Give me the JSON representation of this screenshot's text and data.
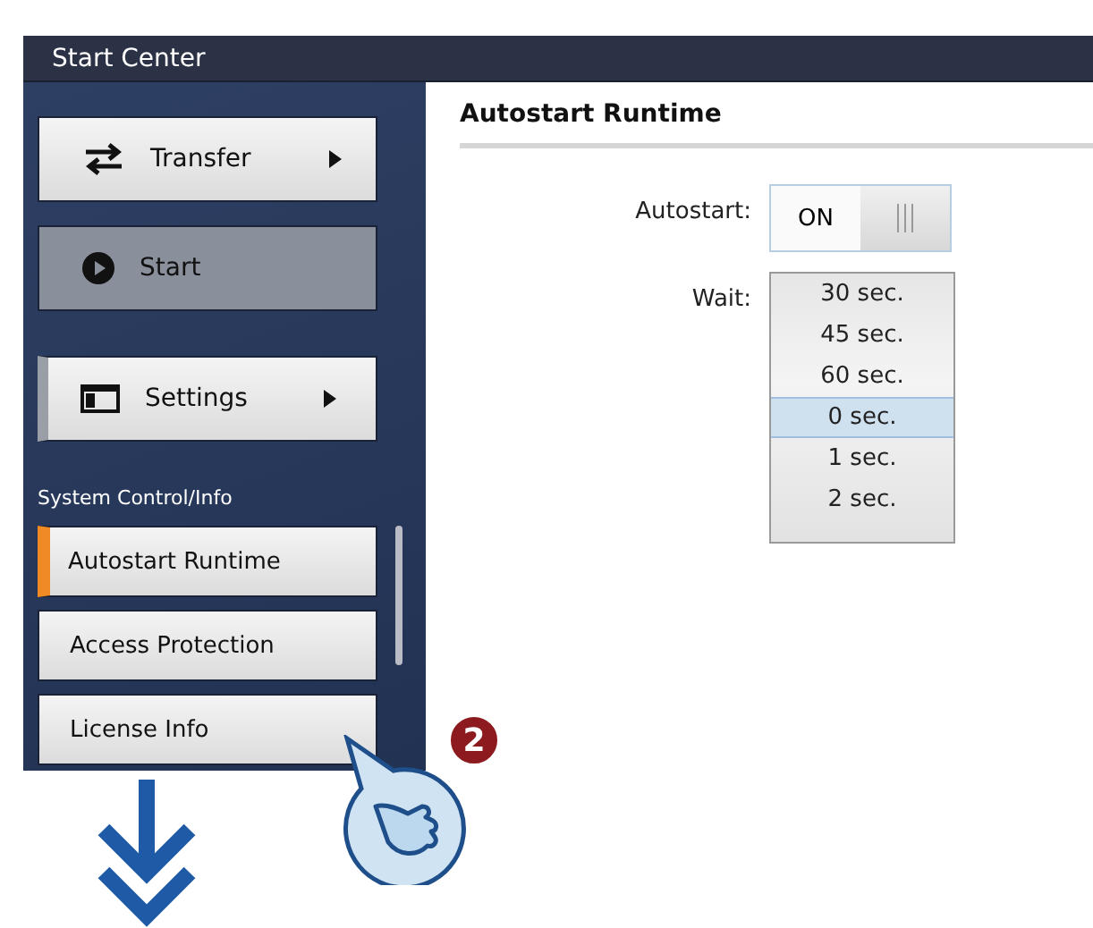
{
  "window": {
    "title": "Start Center"
  },
  "menu": [
    {
      "label": "Transfer",
      "kind": "transfer",
      "submenu": true,
      "expanded": false,
      "selected": false
    },
    {
      "label": "Start",
      "kind": "play",
      "submenu": false,
      "expanded": false,
      "selected": true
    },
    {
      "label": "Settings",
      "kind": "settings",
      "submenu": true,
      "expanded": true,
      "selected": false
    }
  ],
  "section": {
    "title": "System Control/Info",
    "items": [
      {
        "label": "Autostart Runtime",
        "selected": true
      },
      {
        "label": "Access Protection",
        "selected": false
      },
      {
        "label": "License Info",
        "selected": false
      }
    ]
  },
  "content": {
    "title": "Autostart Runtime",
    "autostart": {
      "label": "Autostart:",
      "value": "ON",
      "on": true
    },
    "wait": {
      "label": "Wait:",
      "options": [
        {
          "label": "30 sec.",
          "selected": false
        },
        {
          "label": "45 sec.",
          "selected": false
        },
        {
          "label": "60 sec.",
          "selected": false
        },
        {
          "label": "0 sec.",
          "selected": true
        },
        {
          "label": "1 sec.",
          "selected": false
        },
        {
          "label": "2 sec.",
          "selected": false
        }
      ]
    }
  },
  "callout": {
    "badge": "2"
  }
}
